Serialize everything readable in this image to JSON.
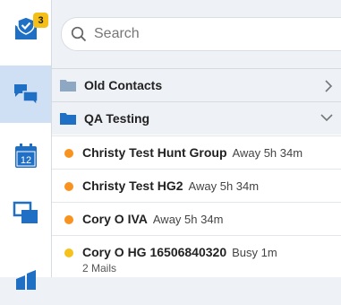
{
  "rail": {
    "tasks_badge": "3",
    "items": [
      {
        "icon": "mail-check-icon"
      },
      {
        "icon": "chat-icon",
        "active": true
      },
      {
        "icon": "calendar-icon",
        "day": "12"
      },
      {
        "icon": "screens-icon"
      },
      {
        "icon": "building-icon"
      }
    ]
  },
  "search": {
    "placeholder": "Search",
    "value": ""
  },
  "groups": [
    {
      "label": "Old Contacts",
      "expanded": false
    },
    {
      "label": "QA Testing",
      "expanded": true
    }
  ],
  "contacts": [
    {
      "name": "Christy Test Hunt Group",
      "status": "Away 5h 34m",
      "presence": "away",
      "color": "#f7931e"
    },
    {
      "name": "Christy Test HG2",
      "status": "Away 5h 34m",
      "presence": "away",
      "color": "#f7931e"
    },
    {
      "name": "Cory O IVA",
      "status": "Away 5h 34m",
      "presence": "away",
      "color": "#f7931e"
    },
    {
      "name": "Cory O HG 16506840320",
      "status": "Busy 1m",
      "presence": "busy",
      "color": "#f5c21b",
      "sub": "2 Mails"
    }
  ],
  "colors": {
    "accent": "#1f6fc5",
    "active_rail": "#cfe0f4",
    "badge": "#f5bf1a",
    "folder": "#8ea7c2"
  }
}
